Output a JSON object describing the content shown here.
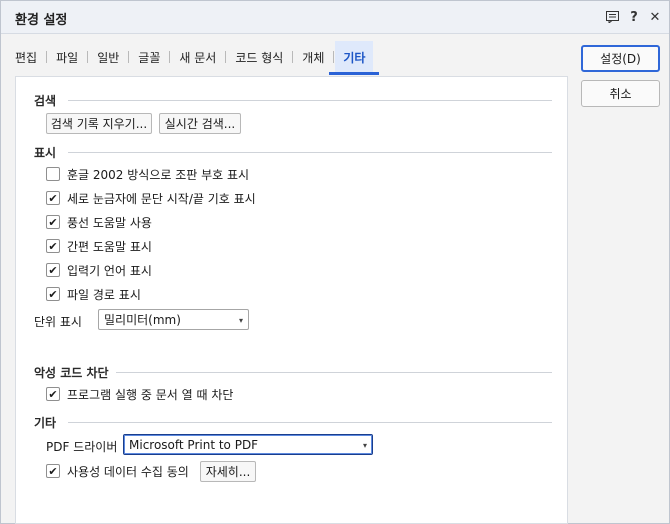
{
  "window": {
    "title": "환경 설정",
    "help_icon_text": "?",
    "close_icon_text": "✕",
    "extra_icon_text": "▤"
  },
  "tabs": [
    {
      "label": "편집"
    },
    {
      "label": "파일"
    },
    {
      "label": "일반"
    },
    {
      "label": "글꼴"
    },
    {
      "label": "새 문서"
    },
    {
      "label": "코드 형식"
    },
    {
      "label": "개체"
    },
    {
      "label": "기타",
      "active": true
    }
  ],
  "search": {
    "title": "검색",
    "clear_history_label": "검색 기록 지우기...",
    "live_search_label": "실시간 검색..."
  },
  "display": {
    "title": "표시",
    "options": [
      {
        "label": "훈글 2002 방식으로 조판 부호 표시",
        "checked": false
      },
      {
        "label": "세로 눈금자에 문단 시작/끝 기호 표시",
        "checked": true
      },
      {
        "label": "풍선 도움말 사용",
        "checked": true
      },
      {
        "label": "간편 도움말 표시",
        "checked": true
      },
      {
        "label": "입력기 언어 표시",
        "checked": true
      },
      {
        "label": "파일 경로 표시",
        "checked": true
      }
    ],
    "unit_label": "단위 표시",
    "unit_value": "밀리미터(mm)"
  },
  "malicious": {
    "title": "악성 코드 차단",
    "option_label": "프로그램 실행 중 문서 열 때 차단",
    "checked": true
  },
  "other": {
    "title": "기타",
    "pdf_driver_label": "PDF 드라이버",
    "pdf_driver_value": "Microsoft Print to PDF",
    "usage_label": "사용성 데이터 수집 동의",
    "usage_checked": true,
    "details_label": "자세히..."
  },
  "actions": {
    "ok_label": "설정(D)",
    "cancel_label": "취소"
  },
  "checkmark": "✔",
  "dropdown_arrow": "▾"
}
